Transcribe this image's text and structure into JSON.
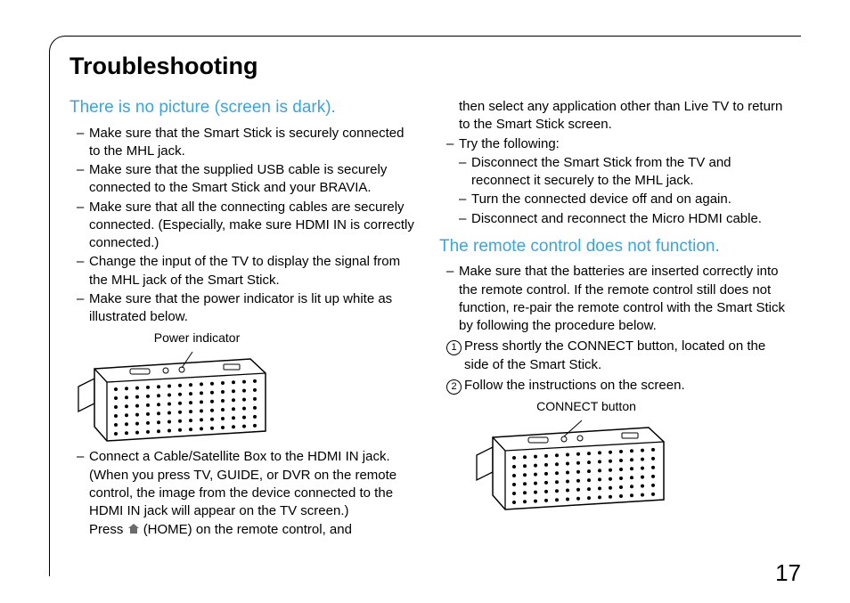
{
  "page_number": "17",
  "section_title": "Troubleshooting",
  "topics": {
    "no_picture": "There is no picture (screen is dark).",
    "remote": "The remote control does not function."
  },
  "dash": "–",
  "left": {
    "b1": "Make sure that the Smart Stick is securely connected to the MHL jack.",
    "b2": "Make sure that the supplied USB cable is securely connected to the Smart Stick and your BRAVIA.",
    "b3": "Make sure that all the connecting cables are securely connected. (Especially, make sure HDMI IN is correctly connected.)",
    "b4": "Change the input of the TV to display the signal from the MHL jack of the Smart Stick.",
    "b5": "Make sure that the power indicator is lit up white as illustrated below.",
    "fig1_label": "Power indicator",
    "b6": "Connect a Cable/Satellite Box to the HDMI IN jack. (When you press TV, GUIDE, or DVR on the remote control, the image from the device connected to the HDMI IN jack will appear on the TV screen.)",
    "press_prefix": "Press ",
    "press_suffix": " (HOME) on the remote control, and"
  },
  "right": {
    "cont1": "then select any application other than Live TV to return to the Smart Stick screen.",
    "b_try": "Try the following:",
    "sub1": "Disconnect the Smart Stick from the TV and reconnect it securely to the MHL jack.",
    "sub2": "Turn the connected device off and on again.",
    "sub3": "Disconnect and reconnect the Micro HDMI cable.",
    "remote_b1": "Make sure that the batteries are inserted correctly into the remote control. If the remote control still does not function, re-pair the remote control with the Smart Stick by following the procedure below.",
    "step1": "Press shortly the CONNECT button, located on the side of the Smart Stick.",
    "step2": "Follow the instructions on the screen.",
    "fig2_label": "CONNECT button"
  }
}
